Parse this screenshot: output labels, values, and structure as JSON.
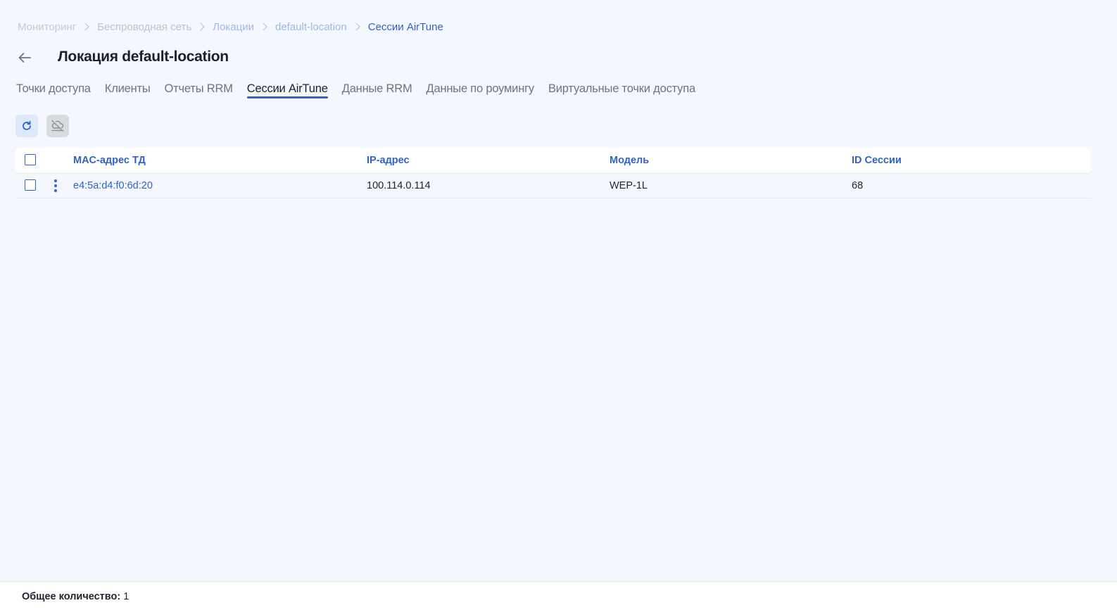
{
  "breadcrumb": {
    "items": [
      "Мониторинг",
      "Беспроводная сеть",
      "Локации",
      "default-location"
    ],
    "current": "Сессии AirTune"
  },
  "header": {
    "title": "Локация default-location",
    "back_icon": "arrow-left-icon"
  },
  "tabs": [
    {
      "label": "Точки доступа",
      "active": false
    },
    {
      "label": "Клиенты",
      "active": false
    },
    {
      "label": "Отчеты RRM",
      "active": false
    },
    {
      "label": "Сессии AirTune",
      "active": true
    },
    {
      "label": "Данные RRM",
      "active": false
    },
    {
      "label": "Данные по роумингу",
      "active": false
    },
    {
      "label": "Виртуальные точки доступа",
      "active": false
    }
  ],
  "toolbar": {
    "refresh_icon": "refresh-icon",
    "disconnect_icon": "cloud-off-icon"
  },
  "table": {
    "columns": {
      "mac": "MAC-адрес ТД",
      "ip": "IP-адрес",
      "model": "Модель",
      "session": "ID Сессии"
    },
    "rows": [
      {
        "mac": "e4:5a:d4:f0:6d:20",
        "ip": "100.114.0.114",
        "model": "WEP-1L",
        "session": "68"
      }
    ]
  },
  "footer": {
    "total_label": "Общее количество:",
    "total_value": "1"
  },
  "colors": {
    "accent": "#2f63c9",
    "background": "#f4f7fd"
  }
}
